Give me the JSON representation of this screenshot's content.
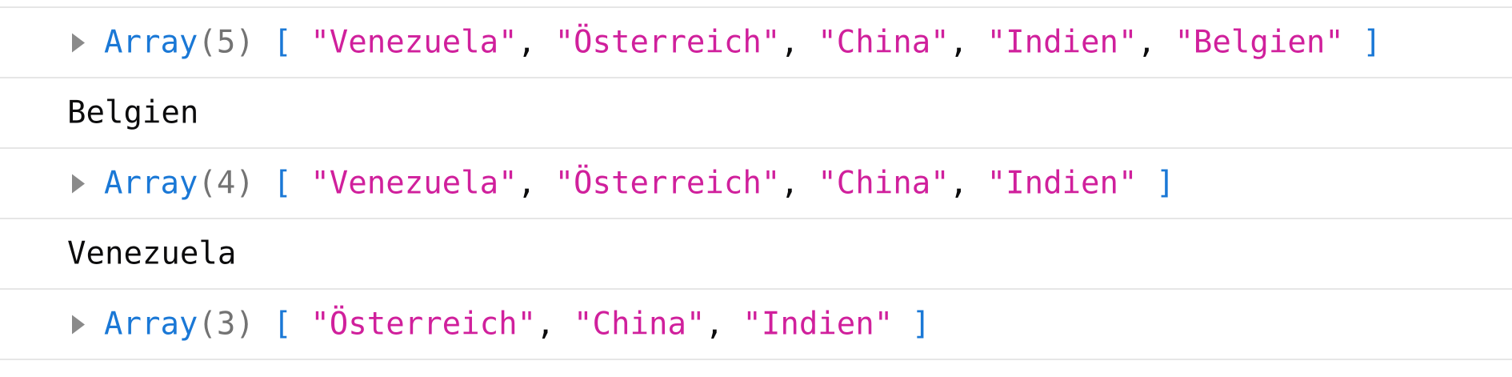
{
  "console": {
    "entries": [
      {
        "type": "array",
        "label": "Array",
        "count": "(5)",
        "open_bracket": "[",
        "close_bracket": "]",
        "items": [
          "\"Venezuela\"",
          "\"Österreich\"",
          "\"China\"",
          "\"Indien\"",
          "\"Belgien\""
        ]
      },
      {
        "type": "log",
        "text": "Belgien"
      },
      {
        "type": "array",
        "label": "Array",
        "count": "(4)",
        "open_bracket": "[",
        "close_bracket": "]",
        "items": [
          "\"Venezuela\"",
          "\"Österreich\"",
          "\"China\"",
          "\"Indien\""
        ]
      },
      {
        "type": "log",
        "text": "Venezuela"
      },
      {
        "type": "array",
        "label": "Array",
        "count": "(3)",
        "open_bracket": "[",
        "close_bracket": "]",
        "items": [
          "\"Österreich\"",
          "\"China\"",
          "\"Indien\""
        ]
      }
    ],
    "separator": ",",
    "colors": {
      "keyword": "#1a78d6",
      "count": "#737373",
      "string": "#d0209c",
      "text": "#0c0c0d",
      "row_border": "#e6e6e6",
      "twisty": "#8a8a8a"
    },
    "icons": {
      "expand": "twisty-right-icon"
    }
  }
}
